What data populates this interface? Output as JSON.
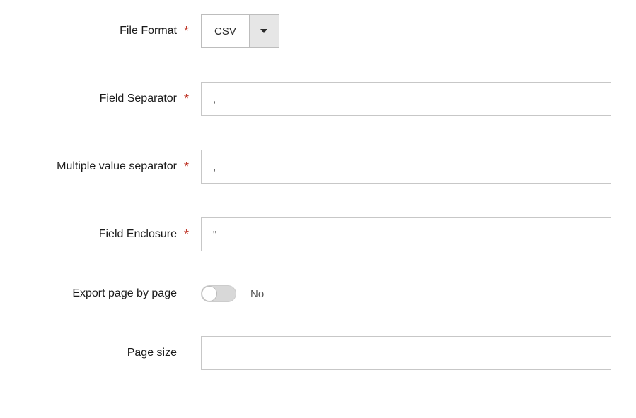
{
  "fields": {
    "file_format": {
      "label": "File Format",
      "required": true,
      "value": "CSV"
    },
    "field_separator": {
      "label": "Field Separator",
      "required": true,
      "value": ","
    },
    "multiple_value_separator": {
      "label": "Multiple value separator",
      "required": true,
      "value": ","
    },
    "field_enclosure": {
      "label": "Field Enclosure",
      "required": true,
      "value": "\""
    },
    "export_page_by_page": {
      "label": "Export page by page",
      "required": false,
      "value": false,
      "display": "No"
    },
    "page_size": {
      "label": "Page size",
      "required": false,
      "value": ""
    }
  },
  "required_symbol": "*"
}
